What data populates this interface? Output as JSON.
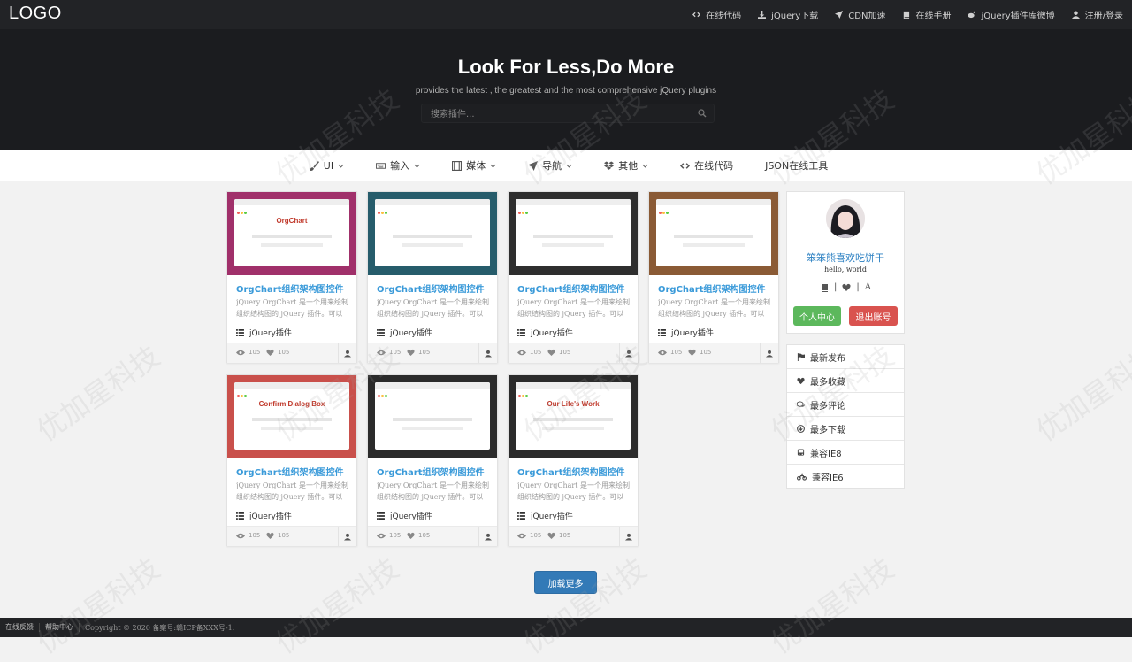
{
  "header": {
    "logo": "LOGO",
    "nav": [
      {
        "label": "在线代码",
        "icon": "code-icon"
      },
      {
        "label": "jQuery下载",
        "icon": "download-icon"
      },
      {
        "label": "CDN加速",
        "icon": "rocket-icon"
      },
      {
        "label": "在线手册",
        "icon": "book-icon"
      },
      {
        "label": "jQuery插件库微博",
        "icon": "weibo-icon"
      },
      {
        "label": "注册/登录",
        "icon": "user-icon"
      }
    ]
  },
  "hero": {
    "title": "Look For Less,Do More",
    "subtitle": "provides the latest , the greatest and the most comprehensive jQuery plugins",
    "search_placeholder": "搜索插件..."
  },
  "categories": [
    {
      "label": "UI",
      "icon": "brush-icon",
      "dropdown": true
    },
    {
      "label": "输入",
      "icon": "keyboard-icon",
      "dropdown": true
    },
    {
      "label": "媒体",
      "icon": "film-icon",
      "dropdown": true
    },
    {
      "label": "导航",
      "icon": "send-icon",
      "dropdown": true
    },
    {
      "label": "其他",
      "icon": "dropbox-icon",
      "dropdown": true
    },
    {
      "label": "在线代码",
      "icon": "code-icon",
      "dropdown": false
    },
    {
      "label": "JSON在线工具",
      "icon": "",
      "dropdown": false
    }
  ],
  "cards": [
    {
      "title": "OrgChart组织架构图控件",
      "desc": "jQuery OrgChart 是一个用来绘制组织结构图的 jQuery 插件。可以自己",
      "tag": "jQuery插件",
      "views": "105",
      "likes": "105",
      "bg": "#a0306a",
      "thumb_label": "OrgChart"
    },
    {
      "title": "OrgChart组织架构图控件",
      "desc": "jQuery OrgChart 是一个用来绘制组织结构图的 jQuery 插件。可以自己",
      "tag": "jQuery插件",
      "views": "105",
      "likes": "105",
      "bg": "#265c6b",
      "thumb_label": ""
    },
    {
      "title": "OrgChart组织架构图控件",
      "desc": "jQuery OrgChart 是一个用来绘制组织结构图的 jQuery 插件。可以自己",
      "tag": "jQuery插件",
      "views": "105",
      "likes": "105",
      "bg": "#2e2e2e",
      "thumb_label": ""
    },
    {
      "title": "OrgChart组织架构图控件",
      "desc": "jQuery OrgChart 是一个用来绘制组织结构图的 jQuery 插件。可以自己",
      "tag": "jQuery插件",
      "views": "105",
      "likes": "105",
      "bg": "#8a5a35",
      "thumb_label": ""
    },
    {
      "title": "OrgChart组织架构图控件",
      "desc": "jQuery OrgChart 是一个用来绘制组织结构图的 jQuery 插件。可以自己",
      "tag": "jQuery插件",
      "views": "105",
      "likes": "105",
      "bg": "#c9504b",
      "thumb_label": "Confirm Dialog Box"
    },
    {
      "title": "OrgChart组织架构图控件",
      "desc": "jQuery OrgChart 是一个用来绘制组织结构图的 jQuery 插件。可以自己",
      "tag": "jQuery插件",
      "views": "105",
      "likes": "105",
      "bg": "#2b2b2b",
      "thumb_label": ""
    },
    {
      "title": "OrgChart组织架构图控件",
      "desc": "jQuery OrgChart 是一个用来绘制组织结构图的 jQuery 插件。可以自己",
      "tag": "jQuery插件",
      "views": "105",
      "likes": "105",
      "bg": "#2b2b2b",
      "thumb_label": "Our Life's Work"
    }
  ],
  "profile": {
    "name": "笨笨熊喜欢吃饼干",
    "motto": "hello, world",
    "icon_sep": "|",
    "icon_letter": "A",
    "center_button": "个人中心",
    "logout_button": "退出账号"
  },
  "sort_list": [
    {
      "label": "最新发布",
      "icon": "flag-icon"
    },
    {
      "label": "最多收藏",
      "icon": "heart-icon"
    },
    {
      "label": "最多评论",
      "icon": "comments-icon"
    },
    {
      "label": "最多下载",
      "icon": "download-circle-icon"
    },
    {
      "label": "兼容IE8",
      "icon": "bus-icon"
    },
    {
      "label": "兼容IE6",
      "icon": "motorcycle-icon"
    }
  ],
  "load_more": "加载更多",
  "footer": {
    "links": [
      "在线反馈",
      "帮助中心"
    ],
    "copyright": "Copyright © 2020 备案号:赣ICP备XXX号-1."
  },
  "watermark": "优加星科技",
  "colors": {
    "accent": "#3a9ad9",
    "primary_button": "#337ab7",
    "success": "#5cb85c",
    "danger": "#d9534f",
    "dark_header": "#222326"
  }
}
